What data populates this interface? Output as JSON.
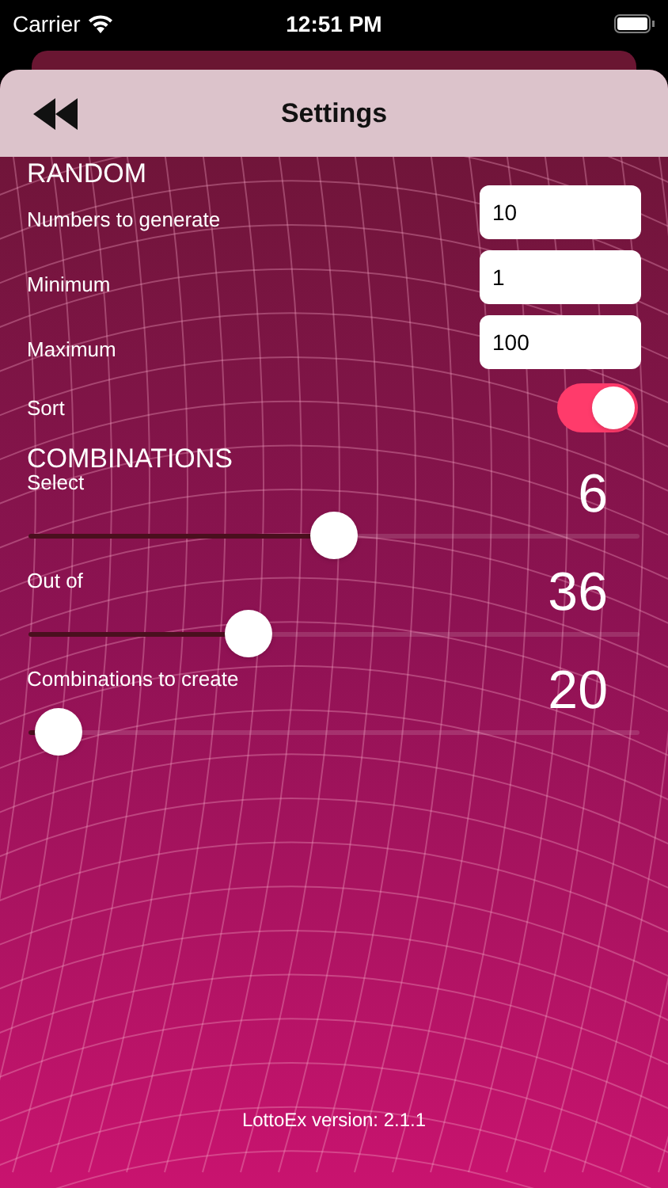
{
  "status_bar": {
    "carrier": "Carrier",
    "time": "12:51 PM"
  },
  "header": {
    "title": "Settings"
  },
  "random": {
    "heading": "RANDOM",
    "fields": [
      {
        "label": "Numbers to generate",
        "value": "10"
      },
      {
        "label": "Minimum",
        "value": "1"
      },
      {
        "label": "Maximum",
        "value": "100"
      }
    ],
    "sort": {
      "label": "Sort",
      "on": true
    }
  },
  "combinations": {
    "heading": "COMBINATIONS",
    "sliders": [
      {
        "label": "Select",
        "value": "6",
        "level": 0.5
      },
      {
        "label": "Out of",
        "value": "36",
        "level": 0.36
      },
      {
        "label": "Combinations to create",
        "value": "20",
        "level": 0.05
      }
    ]
  },
  "footer": "LottoEx version: 2.1.1"
}
